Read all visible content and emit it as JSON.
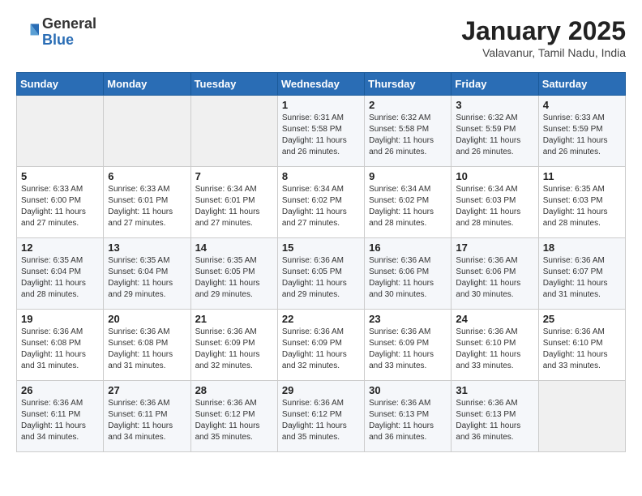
{
  "logo": {
    "general": "General",
    "blue": "Blue"
  },
  "header": {
    "month_title": "January 2025",
    "subtitle": "Valavanur, Tamil Nadu, India"
  },
  "days_of_week": [
    "Sunday",
    "Monday",
    "Tuesday",
    "Wednesday",
    "Thursday",
    "Friday",
    "Saturday"
  ],
  "weeks": [
    [
      {
        "day": "",
        "info": ""
      },
      {
        "day": "",
        "info": ""
      },
      {
        "day": "",
        "info": ""
      },
      {
        "day": "1",
        "info": "Sunrise: 6:31 AM\nSunset: 5:58 PM\nDaylight: 11 hours and 26 minutes."
      },
      {
        "day": "2",
        "info": "Sunrise: 6:32 AM\nSunset: 5:58 PM\nDaylight: 11 hours and 26 minutes."
      },
      {
        "day": "3",
        "info": "Sunrise: 6:32 AM\nSunset: 5:59 PM\nDaylight: 11 hours and 26 minutes."
      },
      {
        "day": "4",
        "info": "Sunrise: 6:33 AM\nSunset: 5:59 PM\nDaylight: 11 hours and 26 minutes."
      }
    ],
    [
      {
        "day": "5",
        "info": "Sunrise: 6:33 AM\nSunset: 6:00 PM\nDaylight: 11 hours and 27 minutes."
      },
      {
        "day": "6",
        "info": "Sunrise: 6:33 AM\nSunset: 6:01 PM\nDaylight: 11 hours and 27 minutes."
      },
      {
        "day": "7",
        "info": "Sunrise: 6:34 AM\nSunset: 6:01 PM\nDaylight: 11 hours and 27 minutes."
      },
      {
        "day": "8",
        "info": "Sunrise: 6:34 AM\nSunset: 6:02 PM\nDaylight: 11 hours and 27 minutes."
      },
      {
        "day": "9",
        "info": "Sunrise: 6:34 AM\nSunset: 6:02 PM\nDaylight: 11 hours and 28 minutes."
      },
      {
        "day": "10",
        "info": "Sunrise: 6:34 AM\nSunset: 6:03 PM\nDaylight: 11 hours and 28 minutes."
      },
      {
        "day": "11",
        "info": "Sunrise: 6:35 AM\nSunset: 6:03 PM\nDaylight: 11 hours and 28 minutes."
      }
    ],
    [
      {
        "day": "12",
        "info": "Sunrise: 6:35 AM\nSunset: 6:04 PM\nDaylight: 11 hours and 28 minutes."
      },
      {
        "day": "13",
        "info": "Sunrise: 6:35 AM\nSunset: 6:04 PM\nDaylight: 11 hours and 29 minutes."
      },
      {
        "day": "14",
        "info": "Sunrise: 6:35 AM\nSunset: 6:05 PM\nDaylight: 11 hours and 29 minutes."
      },
      {
        "day": "15",
        "info": "Sunrise: 6:36 AM\nSunset: 6:05 PM\nDaylight: 11 hours and 29 minutes."
      },
      {
        "day": "16",
        "info": "Sunrise: 6:36 AM\nSunset: 6:06 PM\nDaylight: 11 hours and 30 minutes."
      },
      {
        "day": "17",
        "info": "Sunrise: 6:36 AM\nSunset: 6:06 PM\nDaylight: 11 hours and 30 minutes."
      },
      {
        "day": "18",
        "info": "Sunrise: 6:36 AM\nSunset: 6:07 PM\nDaylight: 11 hours and 31 minutes."
      }
    ],
    [
      {
        "day": "19",
        "info": "Sunrise: 6:36 AM\nSunset: 6:08 PM\nDaylight: 11 hours and 31 minutes."
      },
      {
        "day": "20",
        "info": "Sunrise: 6:36 AM\nSunset: 6:08 PM\nDaylight: 11 hours and 31 minutes."
      },
      {
        "day": "21",
        "info": "Sunrise: 6:36 AM\nSunset: 6:09 PM\nDaylight: 11 hours and 32 minutes."
      },
      {
        "day": "22",
        "info": "Sunrise: 6:36 AM\nSunset: 6:09 PM\nDaylight: 11 hours and 32 minutes."
      },
      {
        "day": "23",
        "info": "Sunrise: 6:36 AM\nSunset: 6:09 PM\nDaylight: 11 hours and 33 minutes."
      },
      {
        "day": "24",
        "info": "Sunrise: 6:36 AM\nSunset: 6:10 PM\nDaylight: 11 hours and 33 minutes."
      },
      {
        "day": "25",
        "info": "Sunrise: 6:36 AM\nSunset: 6:10 PM\nDaylight: 11 hours and 33 minutes."
      }
    ],
    [
      {
        "day": "26",
        "info": "Sunrise: 6:36 AM\nSunset: 6:11 PM\nDaylight: 11 hours and 34 minutes."
      },
      {
        "day": "27",
        "info": "Sunrise: 6:36 AM\nSunset: 6:11 PM\nDaylight: 11 hours and 34 minutes."
      },
      {
        "day": "28",
        "info": "Sunrise: 6:36 AM\nSunset: 6:12 PM\nDaylight: 11 hours and 35 minutes."
      },
      {
        "day": "29",
        "info": "Sunrise: 6:36 AM\nSunset: 6:12 PM\nDaylight: 11 hours and 35 minutes."
      },
      {
        "day": "30",
        "info": "Sunrise: 6:36 AM\nSunset: 6:13 PM\nDaylight: 11 hours and 36 minutes."
      },
      {
        "day": "31",
        "info": "Sunrise: 6:36 AM\nSunset: 6:13 PM\nDaylight: 11 hours and 36 minutes."
      },
      {
        "day": "",
        "info": ""
      }
    ]
  ]
}
